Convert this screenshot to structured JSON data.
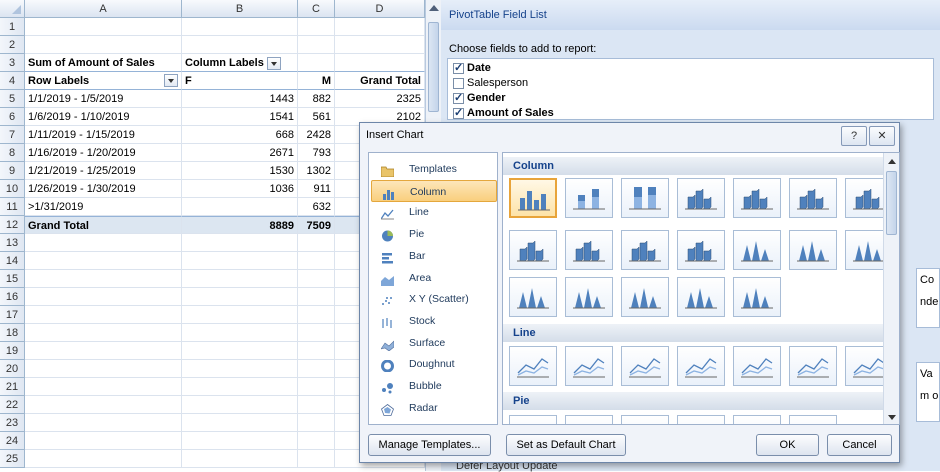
{
  "sheet": {
    "columns": [
      "A",
      "B",
      "C",
      "D"
    ],
    "row_numbers": [
      "1",
      "2",
      "3",
      "4",
      "5",
      "6",
      "7",
      "8",
      "9",
      "10",
      "11",
      "12",
      "13",
      "14",
      "15",
      "16",
      "17",
      "18",
      "19",
      "20",
      "21",
      "22",
      "23",
      "24",
      "25"
    ],
    "pivot_title": "Sum of Amount of Sales",
    "column_labels": "Column Labels",
    "row_labels": "Row Labels",
    "col_f": "F",
    "col_m": "M",
    "grand_total_header": "Grand Total",
    "rows": [
      {
        "label": "1/1/2019 - 1/5/2019",
        "f": "1443",
        "m": "882",
        "total": "2325"
      },
      {
        "label": "1/6/2019 - 1/10/2019",
        "f": "1541",
        "m": "561",
        "total": "2102"
      },
      {
        "label": "1/11/2019 - 1/15/2019",
        "f": "668",
        "m": "2428",
        "total": ""
      },
      {
        "label": "1/16/2019 - 1/20/2019",
        "f": "2671",
        "m": "793",
        "total": ""
      },
      {
        "label": "1/21/2019 - 1/25/2019",
        "f": "1530",
        "m": "1302",
        "total": ""
      },
      {
        "label": "1/26/2019 - 1/30/2019",
        "f": "1036",
        "m": "911",
        "total": ""
      },
      {
        "label": ">1/31/2019",
        "f": "",
        "m": "632",
        "total": ""
      }
    ],
    "grand_total_label": "Grand Total",
    "grand_total_f": "8889",
    "grand_total_m": "7509"
  },
  "pivot_panel": {
    "title": "PivotTable Field List",
    "choose_label": "Choose fields to add to report:",
    "fields": [
      {
        "label": "Date",
        "checked": true
      },
      {
        "label": "Salesperson",
        "checked": false
      },
      {
        "label": "Gender",
        "checked": true
      },
      {
        "label": "Amount of Sales",
        "checked": true
      }
    ],
    "area1_label": "Co",
    "area1_value": "nde",
    "area2_label": "Va",
    "area2_value": "m o",
    "defer_label": "Defer Layout Update"
  },
  "dialog": {
    "title": "Insert Chart",
    "help_icon": "?",
    "close_icon": "✕",
    "chart_types": [
      {
        "label": "Templates",
        "icon": "folder-icon"
      },
      {
        "label": "Column",
        "icon": "column-chart-icon",
        "selected": true
      },
      {
        "label": "Line",
        "icon": "line-chart-icon"
      },
      {
        "label": "Pie",
        "icon": "pie-chart-icon"
      },
      {
        "label": "Bar",
        "icon": "bar-chart-icon"
      },
      {
        "label": "Area",
        "icon": "area-chart-icon"
      },
      {
        "label": "X Y (Scatter)",
        "icon": "scatter-chart-icon"
      },
      {
        "label": "Stock",
        "icon": "stock-chart-icon"
      },
      {
        "label": "Surface",
        "icon": "surface-chart-icon"
      },
      {
        "label": "Doughnut",
        "icon": "doughnut-chart-icon"
      },
      {
        "label": "Bubble",
        "icon": "bubble-chart-icon"
      },
      {
        "label": "Radar",
        "icon": "radar-chart-icon"
      }
    ],
    "section_column": "Column",
    "section_line": "Line",
    "section_pie": "Pie",
    "manage_templates": "Manage Templates...",
    "set_default": "Set as Default Chart",
    "ok": "OK",
    "cancel": "Cancel"
  },
  "colors": {
    "selection_orange": "#f9cf7d",
    "header_blue": "#15428b",
    "total_fill": "#dce6f1"
  }
}
